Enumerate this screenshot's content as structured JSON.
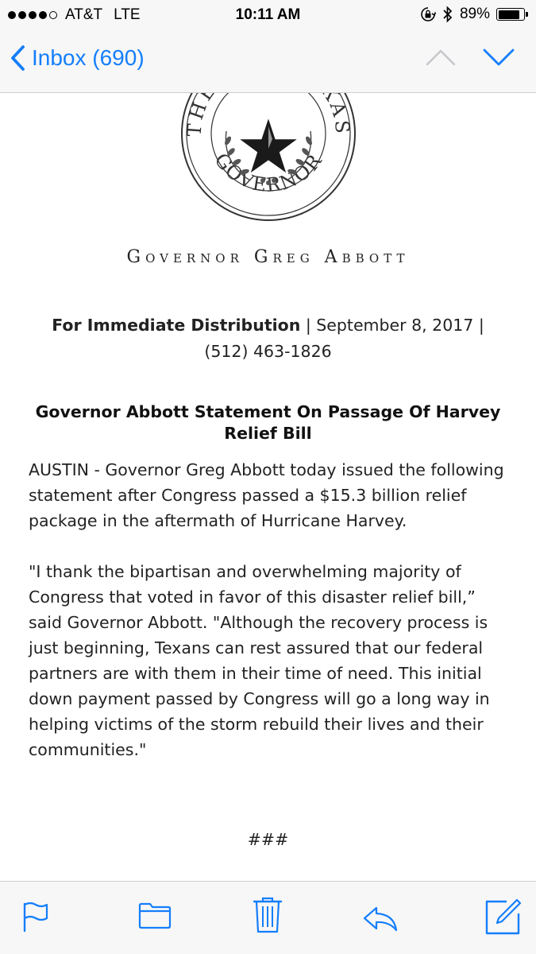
{
  "status_bar": {
    "carrier": "AT&T",
    "network": "LTE",
    "time": "10:11 AM",
    "battery_percent": "89%",
    "battery_level": 0.89,
    "signal_bars_filled": 4,
    "signal_bars_total": 5
  },
  "nav": {
    "back_label": "Inbox (690)",
    "accent_color": "#147efb",
    "prev_icon": "chevron-up-icon",
    "next_icon": "chevron-down-icon"
  },
  "email": {
    "seal_text": "THE GOVERNOR TEXAS",
    "signature_name": "Governor Greg Abbott",
    "distribution_bold": "For Immediate Distribution",
    "distribution_rest": " | September 8, 2017 | (512) 463-1826",
    "headline": "Governor Abbott Statement On Passage Of Harvey Relief Bill",
    "paragraphs": [
      "AUSTIN - Governor Greg Abbott today issued the following statement after Congress passed a $15.3 billion relief package in the aftermath of Hurricane Harvey.",
      "\"I thank the bipartisan and overwhelming majority of Congress that voted in favor of this disaster relief bill,” said Governor Abbott. \"Although the recovery process is just beginning, Texans can rest assured that our federal partners are with them in their time of need. This initial down payment passed by Congress will go a long way in helping victims of the storm rebuild their lives and their communities.\""
    ],
    "end_mark": "###"
  },
  "toolbar": {
    "items": [
      "flag-icon",
      "folder-icon",
      "trash-icon",
      "reply-icon",
      "compose-icon"
    ]
  }
}
